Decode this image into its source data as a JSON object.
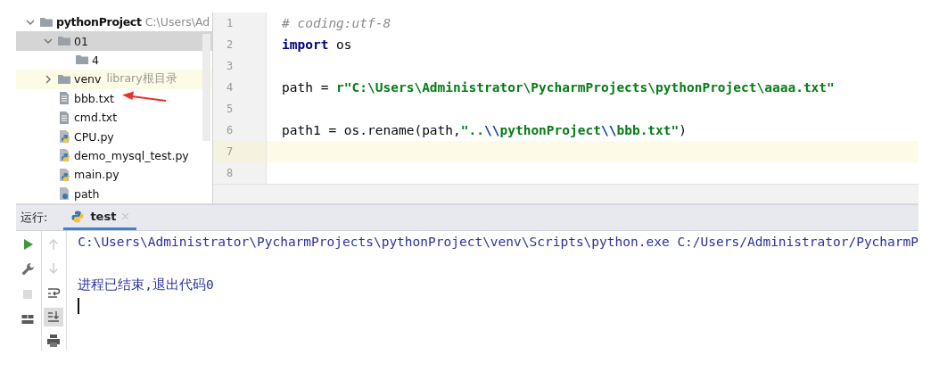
{
  "project_tree": {
    "items": [
      {
        "label": "pythonProject",
        "path": "C:\\Users\\Ad",
        "kind": "project",
        "expanded": true,
        "selected": false,
        "highlighted": false,
        "marked": false,
        "children": [
          {
            "label": "01",
            "kind": "folder",
            "expanded": true,
            "selected": true,
            "highlighted": false,
            "marked": false,
            "children": [
              {
                "label": "4",
                "kind": "folder",
                "selected": false,
                "highlighted": false,
                "marked": false
              }
            ]
          },
          {
            "label": "venv",
            "note": "library根目录",
            "kind": "folder",
            "expanded": false,
            "selected": false,
            "highlighted": true,
            "marked": false
          },
          {
            "label": "bbb.txt",
            "kind": "text",
            "selected": false,
            "highlighted": false,
            "marked": true
          },
          {
            "label": "cmd.txt",
            "kind": "text",
            "selected": false,
            "highlighted": false,
            "marked": false
          },
          {
            "label": "CPU.py",
            "kind": "python",
            "selected": false,
            "highlighted": false,
            "marked": false
          },
          {
            "label": "demo_mysql_test.py",
            "kind": "python",
            "selected": false,
            "highlighted": false,
            "marked": false
          },
          {
            "label": "main.py",
            "kind": "python",
            "selected": false,
            "highlighted": false,
            "marked": false
          },
          {
            "label": "path",
            "kind": "unknown",
            "selected": false,
            "highlighted": false,
            "marked": false
          }
        ]
      }
    ]
  },
  "editor": {
    "lines": [
      {
        "number": "1",
        "current": false,
        "tokens": [
          {
            "text": "# coding:utf-8",
            "kind": "comment"
          }
        ]
      },
      {
        "number": "2",
        "current": false,
        "tokens": [
          {
            "text": "import",
            "kind": "keyword"
          },
          {
            "text": " os",
            "kind": "plain"
          }
        ]
      },
      {
        "number": "3",
        "current": false
      },
      {
        "number": "4",
        "current": false,
        "tokens": [
          {
            "text": "path = ",
            "kind": "plain"
          },
          {
            "text": "r\"C:\\Users\\Administrator\\PycharmProjects\\pythonProject\\aaaa.txt\"",
            "kind": "string"
          }
        ]
      },
      {
        "number": "5",
        "current": false
      },
      {
        "number": "6",
        "current": false,
        "tokens": [
          {
            "text": "path1 = os.rename(path,",
            "kind": "plain"
          },
          {
            "text": "\"..",
            "kind": "string"
          },
          {
            "text": "\\\\",
            "kind": "escape"
          },
          {
            "text": "pythonProject",
            "kind": "string"
          },
          {
            "text": "\\\\",
            "kind": "escape"
          },
          {
            "text": "bbb.txt\"",
            "kind": "string"
          },
          {
            "text": ")",
            "kind": "plain"
          }
        ]
      },
      {
        "number": "7",
        "current": true
      },
      {
        "number": "8",
        "current": false
      }
    ]
  },
  "run_panel": {
    "label": "运行:",
    "tabs": [
      {
        "label": "test",
        "selected": true
      }
    ],
    "toolbar_left": [
      {
        "kind": "run",
        "disabled": false,
        "selected": false
      },
      {
        "kind": "wrench",
        "disabled": false,
        "selected": false
      },
      {
        "kind": "stop",
        "disabled": true,
        "selected": false
      },
      {
        "kind": "layout",
        "disabled": false,
        "selected": false
      }
    ],
    "toolbar_right": [
      {
        "kind": "up",
        "disabled": true,
        "selected": false
      },
      {
        "kind": "down",
        "disabled": true,
        "selected": false
      },
      {
        "kind": "wrap",
        "disabled": false,
        "selected": false
      },
      {
        "kind": "scroll_end",
        "disabled": false,
        "selected": true
      },
      {
        "kind": "print",
        "disabled": false,
        "selected": false
      }
    ],
    "output": [
      {
        "kind": "command",
        "text": "C:\\Users\\Administrator\\PycharmProjects\\pythonProject\\venv\\Scripts\\python.exe C:/Users/Administrator/PycharmP"
      },
      {
        "kind": "blank"
      },
      {
        "kind": "message",
        "text": "进程已结束,退出代码0"
      },
      {
        "kind": "cursor"
      }
    ]
  }
}
